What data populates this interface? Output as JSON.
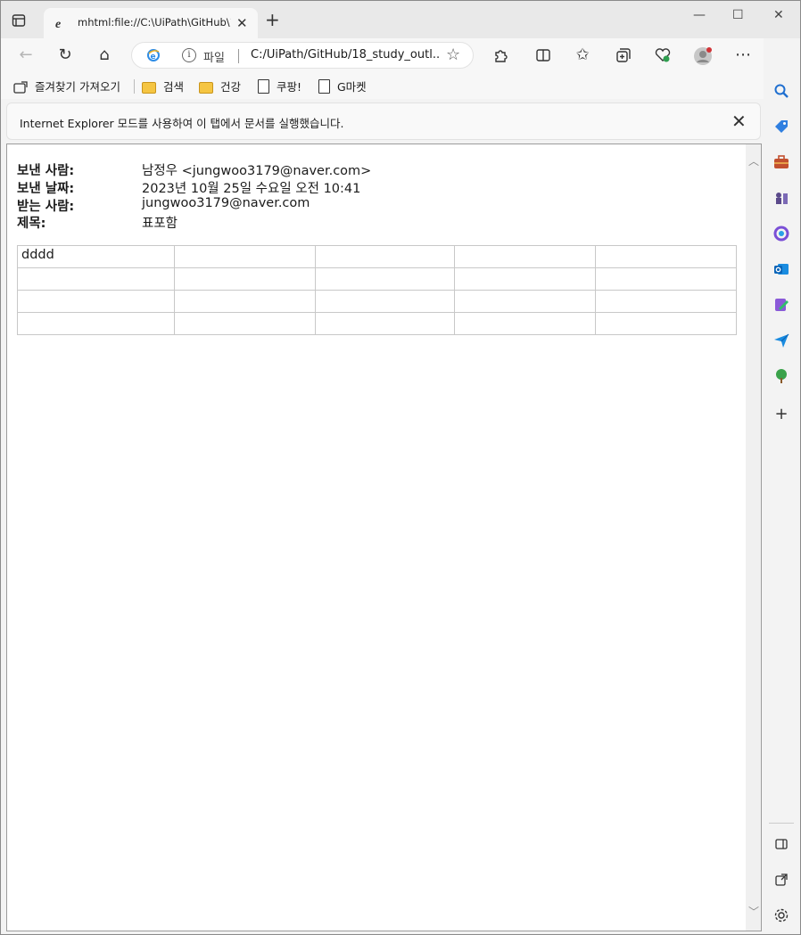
{
  "tab": {
    "title": "mhtml:file://C:\\UiPath\\GitHub\\18",
    "close": "✕"
  },
  "toolbar": {
    "scheme": "파일",
    "url": "C:/UiPath/GitHub/18_study_outl..."
  },
  "bookmarks": [
    {
      "label": "즐겨찾기 가져오기",
      "icon": "import-favorites-icon"
    },
    {
      "label": "검색",
      "icon": "folder-icon"
    },
    {
      "label": "건강",
      "icon": "folder-icon"
    },
    {
      "label": "쿠팡!",
      "icon": "page-icon"
    },
    {
      "label": "G마켓",
      "icon": "page-icon"
    }
  ],
  "banner": {
    "message": "Internet Explorer 모드를 사용하여 이 탭에서 문서를 실행했습니다."
  },
  "email": {
    "from_label": "보낸 사람:",
    "from_value": "남정우 <jungwoo3179@naver.com>",
    "date_label": "보낸 날짜:",
    "date_value": "2023년 10월 25일 수요일 오전 10:41",
    "to_label": "받는 사람:",
    "to_value": "jungwoo3179@naver.com",
    "subject_label": "제목:",
    "subject_value": "표포함"
  },
  "table": {
    "rows": [
      [
        "dddd",
        "",
        "",
        "",
        ""
      ],
      [
        "",
        "",
        "",
        "",
        ""
      ],
      [
        "",
        "",
        "",
        "",
        ""
      ],
      [
        "",
        "",
        "",
        "",
        ""
      ]
    ]
  },
  "colors": {
    "accent": "#0067c0",
    "banner_bg": "#f9f9f9",
    "folder": "#f5c542"
  }
}
